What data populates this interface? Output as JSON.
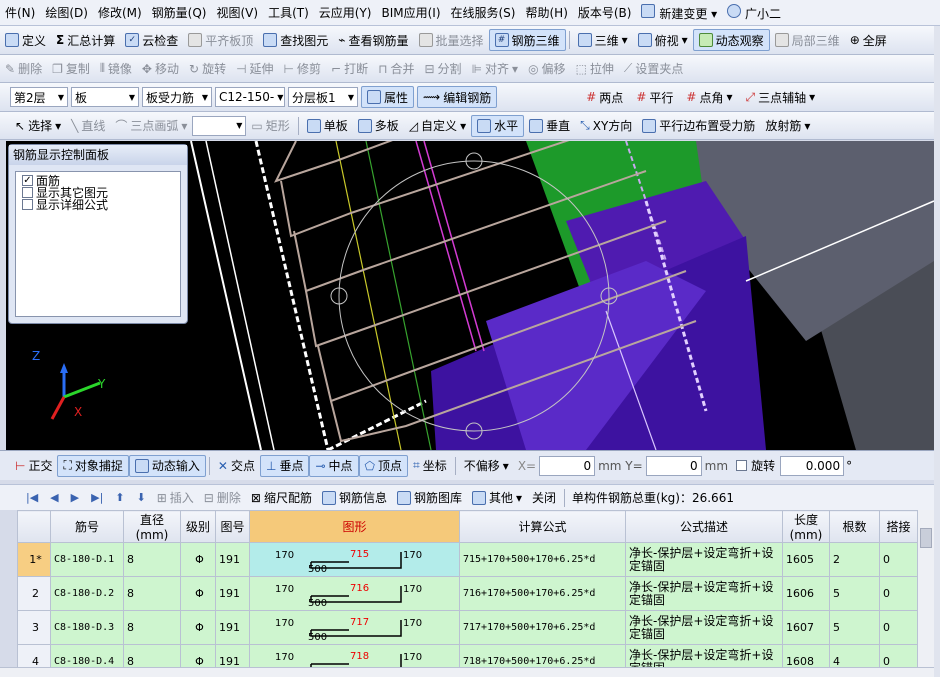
{
  "menu": [
    "件(N)",
    "绘图(D)",
    "修改(M)",
    "钢筋量(Q)",
    "视图(V)",
    "工具(T)",
    "云应用(Y)",
    "BIM应用(I)",
    "在线服务(S)",
    "帮助(H)",
    "版本号(B)",
    "新建变更",
    "广小二"
  ],
  "tb1": [
    "定义",
    "汇总计算",
    "云检查",
    "平齐板顶",
    "查找图元",
    "查看钢筋量",
    "批量选择",
    "钢筋三维",
    "三维",
    "俯视",
    "动态观察",
    "局部三维",
    "全屏"
  ],
  "tb2": [
    "删除",
    "复制",
    "镜像",
    "移动",
    "旋转",
    "延伸",
    "修剪",
    "打断",
    "合并",
    "分割",
    "对齐",
    "偏移",
    "拉伸",
    "设置夹点"
  ],
  "tb3": {
    "floor": "第2层",
    "type": "板",
    "subtype": "板受力筋",
    "spec": "C12-150-",
    "layer": "分层板1",
    "attr": "属性",
    "edit": "编辑钢筋",
    "two_points": "两点",
    "parallel": "平行",
    "point_angle": "点角",
    "three_point_axis": "三点辅轴"
  },
  "tb4": [
    "选择",
    "直线",
    "三点画弧",
    "矩形",
    "单板",
    "多板",
    "自定义",
    "水平",
    "垂直",
    "XY方向",
    "平行边布置受力筋",
    "放射筋"
  ],
  "panel": {
    "title": "钢筋显示控制面板",
    "items": [
      {
        "label": "面筋",
        "checked": true
      },
      {
        "label": "显示其它图元",
        "checked": false
      },
      {
        "label": "显示详细公式",
        "checked": false
      }
    ]
  },
  "snap": {
    "items": [
      "正交",
      "对象捕捉",
      "动态输入",
      "交点",
      "垂点",
      "中点",
      "顶点",
      "坐标"
    ],
    "offset": "不偏移",
    "x_label": "X=",
    "x_val": "0",
    "y_label": "mm Y=",
    "y_val": "0",
    "y_unit": "mm",
    "rotate_label": "旋转",
    "rotate_val": "0.000",
    "deg": "°"
  },
  "gridbar": {
    "items": [
      "插入",
      "删除",
      "缩尺配筋",
      "钢筋信息",
      "钢筋图库",
      "其他",
      "关闭"
    ],
    "total": "单构件钢筋总重(kg)：26.661"
  },
  "table": {
    "headers": [
      "筋号",
      "直径(mm)",
      "级别",
      "图号",
      "图形",
      "计算公式",
      "公式描述",
      "长度(mm)",
      "根数",
      "搭接"
    ],
    "rows": [
      {
        "rn": "1*",
        "name": "C8-180-D.1",
        "dia": "8",
        "grade": "Φ",
        "fig": "191",
        "s_left": "170",
        "s_mid": "715",
        "s_right": "170",
        "s_bottom": "500",
        "formula": "715+170+500+170+6.25*d",
        "desc": "净长-保护层+设定弯折+设定锚固",
        "len": "1605",
        "cnt": "2",
        "lap": "0"
      },
      {
        "rn": "2",
        "name": "C8-180-D.2",
        "dia": "8",
        "grade": "Φ",
        "fig": "191",
        "s_left": "170",
        "s_mid": "716",
        "s_right": "170",
        "s_bottom": "500",
        "formula": "716+170+500+170+6.25*d",
        "desc": "净长-保护层+设定弯折+设定锚固",
        "len": "1606",
        "cnt": "5",
        "lap": "0"
      },
      {
        "rn": "3",
        "name": "C8-180-D.3",
        "dia": "8",
        "grade": "Φ",
        "fig": "191",
        "s_left": "170",
        "s_mid": "717",
        "s_right": "170",
        "s_bottom": "500",
        "formula": "717+170+500+170+6.25*d",
        "desc": "净长-保护层+设定弯折+设定锚固",
        "len": "1607",
        "cnt": "5",
        "lap": "0"
      },
      {
        "rn": "4",
        "name": "C8-180-D.4",
        "dia": "8",
        "grade": "Φ",
        "fig": "191",
        "s_left": "170",
        "s_mid": "718",
        "s_right": "170",
        "s_bottom": "500",
        "formula": "718+170+500+170+6.25*d",
        "desc": "净长-保护层+设定弯折+设定锚固",
        "len": "1608",
        "cnt": "4",
        "lap": "0"
      }
    ]
  },
  "axes": {
    "z": "Z",
    "y": "Y",
    "x": "X"
  }
}
